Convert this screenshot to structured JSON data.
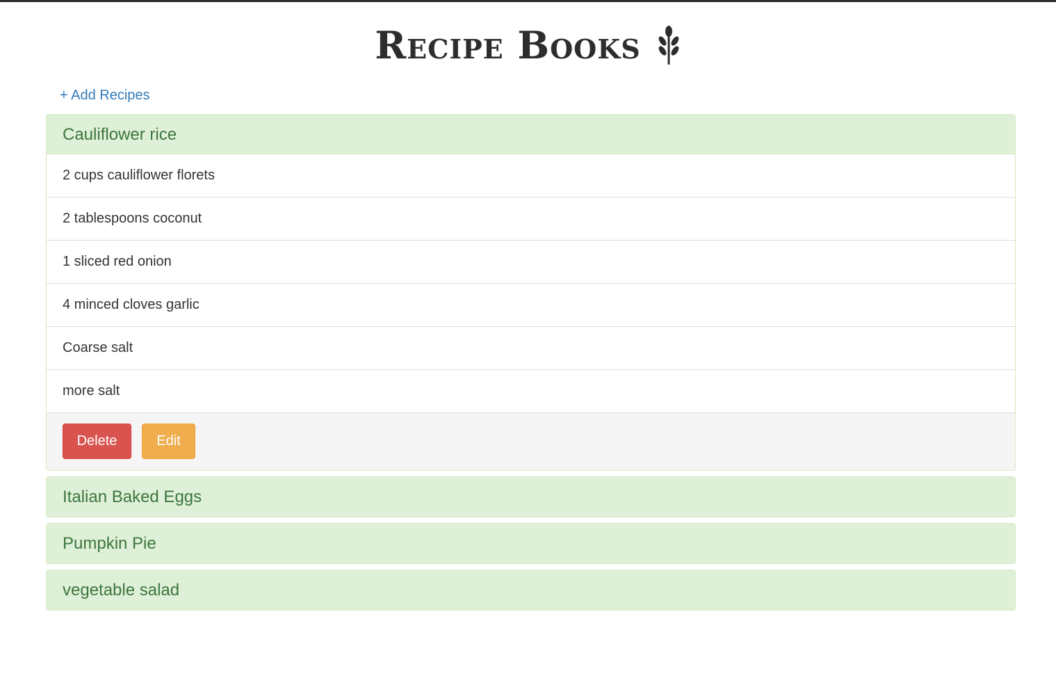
{
  "header": {
    "title": "Recipe Books",
    "icon": "wheat-icon"
  },
  "actions": {
    "add_label": "+ Add Recipes"
  },
  "colors": {
    "link": "#337ab7",
    "panel_heading_bg": "#dff0d8",
    "panel_heading_text": "#3c763d",
    "delete": "#d9534f",
    "edit": "#f0ad4e"
  },
  "recipes": [
    {
      "name": "Cauliflower rice",
      "expanded": true,
      "ingredients": [
        "2 cups cauliflower florets",
        "2 tablespoons coconut",
        "1 sliced red onion",
        "4 minced cloves garlic",
        "Coarse salt",
        "more salt"
      ],
      "delete_label": "Delete",
      "edit_label": "Edit"
    },
    {
      "name": "Italian Baked Eggs",
      "expanded": false
    },
    {
      "name": "Pumpkin Pie",
      "expanded": false
    },
    {
      "name": "vegetable salad",
      "expanded": false
    }
  ]
}
